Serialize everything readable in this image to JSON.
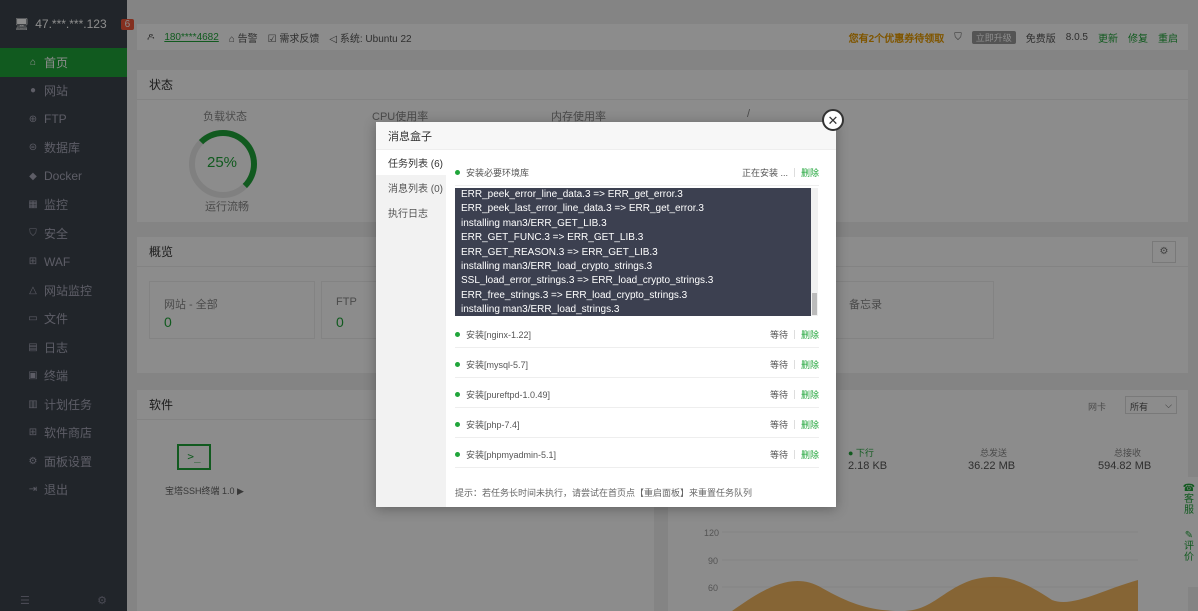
{
  "sidebar": {
    "ip": "47.***.***.123",
    "badge": "6",
    "items": [
      {
        "label": "首页",
        "icon": "⌂",
        "active": true
      },
      {
        "label": "网站",
        "icon": "●"
      },
      {
        "label": "FTP",
        "icon": "⊕"
      },
      {
        "label": "数据库",
        "icon": "⊜"
      },
      {
        "label": "Docker",
        "icon": "◆"
      },
      {
        "label": "监控",
        "icon": "▦"
      },
      {
        "label": "安全",
        "icon": "⛉"
      },
      {
        "label": "WAF",
        "icon": "⊞"
      },
      {
        "label": "网站监控",
        "icon": "△"
      },
      {
        "label": "文件",
        "icon": "▭"
      },
      {
        "label": "日志",
        "icon": "▤"
      },
      {
        "label": "终端",
        "icon": "▣"
      },
      {
        "label": "计划任务",
        "icon": "▥"
      },
      {
        "label": "软件商店",
        "icon": "⊞"
      },
      {
        "label": "面板设置",
        "icon": "⚙"
      },
      {
        "label": "退出",
        "icon": "⇥"
      }
    ]
  },
  "topbar": {
    "user": "180****4682",
    "alert": "告警",
    "feedback": "需求反馈",
    "system": "系统: Ubuntu 22",
    "promo": "您有2个优惠券待领取",
    "plan_pill": "立即升级",
    "edition": "免费版",
    "version": "8.0.5",
    "update": "更新",
    "repair": "修复",
    "restart": "重启"
  },
  "status": {
    "title": "状态",
    "load_label": "负载状态",
    "load_value": "25%",
    "load_sub": "运行流畅",
    "cpu_label": "CPU使用率",
    "mem_label": "内存使用率",
    "disk_label": "/"
  },
  "overview": {
    "title": "概览",
    "cards": [
      {
        "title": "网站 - 全部",
        "value": "0"
      },
      {
        "title": "FTP",
        "value": "0"
      },
      {
        "title": "备忘录",
        "value": ""
      }
    ]
  },
  "software": {
    "title": "软件",
    "app_label": "宝塔SSH终端 1.0 ▶"
  },
  "traffic": {
    "nic_label": "网卡",
    "nic_value": "所有",
    "down_label": "● 下行",
    "down_value": "2.18 KB",
    "sent_label": "总发送",
    "sent_value": "36.22 MB",
    "recv_label": "总接收",
    "recv_value": "594.82 MB",
    "y_ticks": [
      "120",
      "90",
      "60"
    ]
  },
  "side_tools": {
    "service": "客服",
    "rating": "评价"
  },
  "modal": {
    "title": "消息盒子",
    "nav": [
      "任务列表 (6)",
      "消息列表 (0)",
      "执行日志"
    ],
    "current_task": {
      "name": "安装必要环境库",
      "status": "正在安装 ...",
      "delete": "删除"
    },
    "log_lines": [
      "ERR_peek_error_line_data.3 => ERR_get_error.3",
      "ERR_peek_last_error_line_data.3 => ERR_get_error.3",
      "installing man3/ERR_GET_LIB.3",
      "ERR_GET_FUNC.3 => ERR_GET_LIB.3",
      "ERR_GET_REASON.3 => ERR_GET_LIB.3",
      "installing man3/ERR_load_crypto_strings.3",
      "SSL_load_error_strings.3 => ERR_load_crypto_strings.3",
      "ERR_free_strings.3 => ERR_load_crypto_strings.3",
      "installing man3/ERR_load_strings.3"
    ],
    "tasks": [
      {
        "name": "安装[nginx-1.22]",
        "status": "等待",
        "delete": "删除"
      },
      {
        "name": "安装[mysql-5.7]",
        "status": "等待",
        "delete": "删除"
      },
      {
        "name": "安装[pureftpd-1.0.49]",
        "status": "等待",
        "delete": "删除"
      },
      {
        "name": "安装[php-7.4]",
        "status": "等待",
        "delete": "删除"
      },
      {
        "name": "安装[phpmyadmin-5.1]",
        "status": "等待",
        "delete": "删除"
      }
    ],
    "hint": "提示：若任务长时间未执行，请尝试在首页点【重启面板】来重置任务队列"
  }
}
